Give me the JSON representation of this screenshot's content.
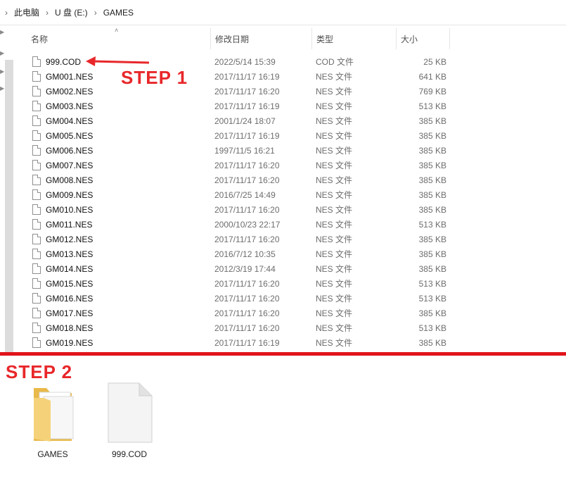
{
  "breadcrumb": [
    "此电脑",
    "U 盘 (E:)",
    "GAMES"
  ],
  "columns": {
    "name": "名称",
    "date": "修改日期",
    "type": "类型",
    "size": "大小"
  },
  "files": [
    {
      "name": "999.COD",
      "date": "2022/5/14 15:39",
      "type": "COD 文件",
      "size": "25 KB"
    },
    {
      "name": "GM001.NES",
      "date": "2017/11/17 16:19",
      "type": "NES 文件",
      "size": "641 KB"
    },
    {
      "name": "GM002.NES",
      "date": "2017/11/17 16:20",
      "type": "NES 文件",
      "size": "769 KB"
    },
    {
      "name": "GM003.NES",
      "date": "2017/11/17 16:19",
      "type": "NES 文件",
      "size": "513 KB"
    },
    {
      "name": "GM004.NES",
      "date": "2001/1/24 18:07",
      "type": "NES 文件",
      "size": "385 KB"
    },
    {
      "name": "GM005.NES",
      "date": "2017/11/17 16:19",
      "type": "NES 文件",
      "size": "385 KB"
    },
    {
      "name": "GM006.NES",
      "date": "1997/11/5 16:21",
      "type": "NES 文件",
      "size": "385 KB"
    },
    {
      "name": "GM007.NES",
      "date": "2017/11/17 16:20",
      "type": "NES 文件",
      "size": "385 KB"
    },
    {
      "name": "GM008.NES",
      "date": "2017/11/17 16:20",
      "type": "NES 文件",
      "size": "385 KB"
    },
    {
      "name": "GM009.NES",
      "date": "2016/7/25 14:49",
      "type": "NES 文件",
      "size": "385 KB"
    },
    {
      "name": "GM010.NES",
      "date": "2017/11/17 16:20",
      "type": "NES 文件",
      "size": "385 KB"
    },
    {
      "name": "GM011.NES",
      "date": "2000/10/23 22:17",
      "type": "NES 文件",
      "size": "513 KB"
    },
    {
      "name": "GM012.NES",
      "date": "2017/11/17 16:20",
      "type": "NES 文件",
      "size": "385 KB"
    },
    {
      "name": "GM013.NES",
      "date": "2016/7/12 10:35",
      "type": "NES 文件",
      "size": "385 KB"
    },
    {
      "name": "GM014.NES",
      "date": "2012/3/19 17:44",
      "type": "NES 文件",
      "size": "385 KB"
    },
    {
      "name": "GM015.NES",
      "date": "2017/11/17 16:20",
      "type": "NES 文件",
      "size": "513 KB"
    },
    {
      "name": "GM016.NES",
      "date": "2017/11/17 16:20",
      "type": "NES 文件",
      "size": "513 KB"
    },
    {
      "name": "GM017.NES",
      "date": "2017/11/17 16:20",
      "type": "NES 文件",
      "size": "385 KB"
    },
    {
      "name": "GM018.NES",
      "date": "2017/11/17 16:20",
      "type": "NES 文件",
      "size": "513 KB"
    },
    {
      "name": "GM019.NES",
      "date": "2017/11/17 16:19",
      "type": "NES 文件",
      "size": "385 KB"
    }
  ],
  "annotations": {
    "step1": "STEP 1",
    "step2": "STEP 2"
  },
  "bottom_items": [
    {
      "label": "GAMES",
      "icon": "folder-icon"
    },
    {
      "label": "999.COD",
      "icon": "file-icon"
    }
  ],
  "colors": {
    "accent_red": "#e8272a",
    "divider_red": "#e0141a",
    "folder_yellow": "#f5d27a"
  }
}
